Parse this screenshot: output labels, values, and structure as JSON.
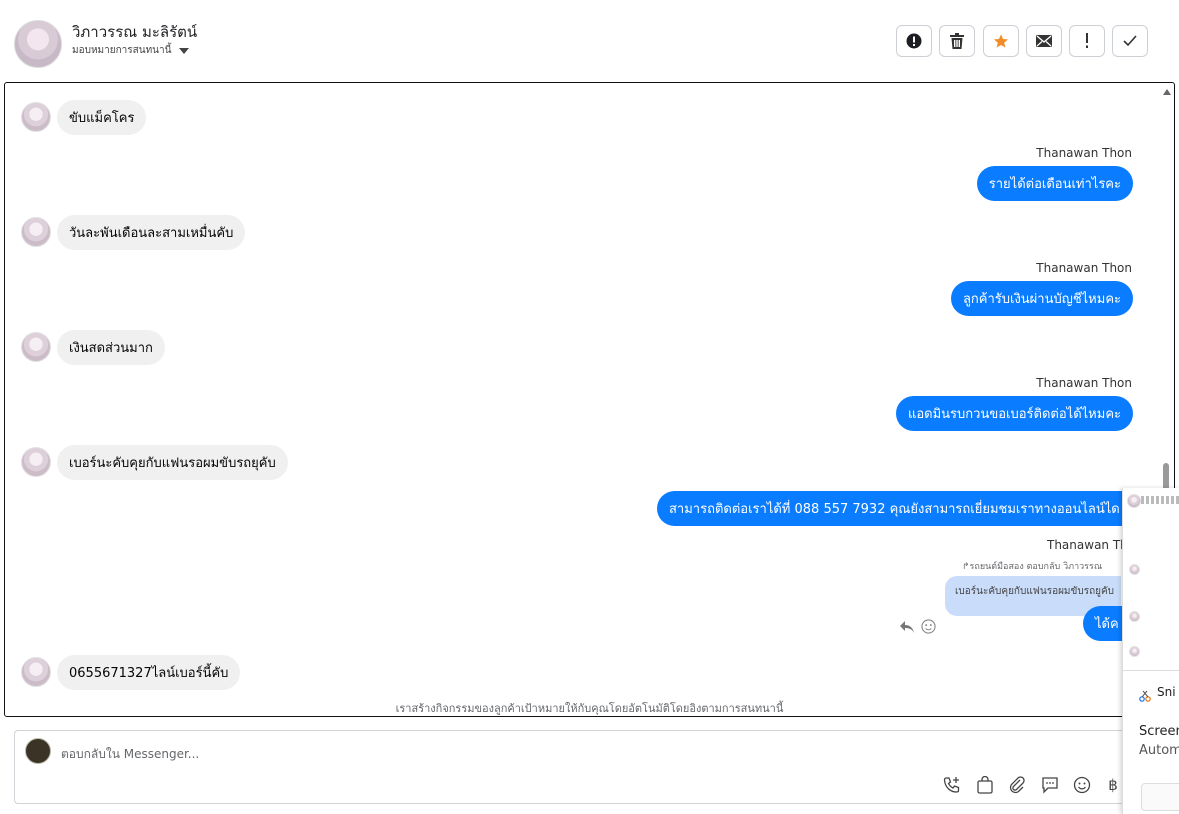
{
  "header": {
    "contact_name": "วิภาวรรณ มะลิรัตน์",
    "assign_label": "มอบหมายการสนทนานี้",
    "toolbar": [
      {
        "name": "spam-button",
        "icon": "alert-circle-icon"
      },
      {
        "name": "delete-button",
        "icon": "trash-icon"
      },
      {
        "name": "star-button",
        "icon": "star-icon",
        "color": "#f28c28"
      },
      {
        "name": "mark-unread-button",
        "icon": "envelope-icon"
      },
      {
        "name": "mark-important-button",
        "icon": "exclamation-icon"
      },
      {
        "name": "done-button",
        "icon": "check-icon"
      }
    ]
  },
  "messages": [
    {
      "dir": "in",
      "text": "ขับแม็คโคร"
    },
    {
      "dir": "out",
      "sender": "Thanawan Thon",
      "text": "รายได้ต่อเดือนเท่าไรคะ"
    },
    {
      "dir": "in",
      "text": "วันละพันเดือนละสามเหมื่นคับ"
    },
    {
      "dir": "out",
      "sender": "Thanawan Thon",
      "text": "ลูกค้ารับเงินผ่านบัญชีไหมคะ"
    },
    {
      "dir": "in",
      "text": "เงินสดส่วนมาก"
    },
    {
      "dir": "out",
      "sender": "Thanawan Thon",
      "text": "แอดมินรบกวนขอเบอร์ติดต่อได้ไหมคะ"
    },
    {
      "dir": "in",
      "text": "เบอร์นะคับคุยกับแฟนรอผมขับรถยุคับ"
    },
    {
      "dir": "out",
      "text": "สามารถติดต่อเราได้ที่ 088 557 7932 คุณยังสามารถเยี่ยมชมเราทางออนไลน์ได"
    },
    {
      "dir": "out",
      "sender": "Thanawan Tho",
      "reply_meta": "รถยนต์มือสอง ตอบกลับ วิภาวรรณ",
      "quoted": "เบอร์นะคับคุยกับแฟนรอผมขับรถยูคับ",
      "text": "ได้ค"
    },
    {
      "dir": "in",
      "text": "0655671327ไลน์เบอร์นี้คับ"
    }
  ],
  "footer_note": "เราสร้างกิจกรรมของลูกค้าเป้าหมายให้กับคุณโดยอัตโนมัติโดยอิงตามการสนทนานี้",
  "composer": {
    "placeholder": "ตอบกลับใน Messenger...",
    "tools": [
      "phone-add-icon",
      "shopping-bag-icon",
      "paperclip-icon",
      "chat-bubble-icon",
      "emoji-icon",
      "baht-icon"
    ]
  },
  "overlay": {
    "app_label": "Sni",
    "line1": "Screen",
    "line2": "Autom"
  },
  "colors": {
    "accent": "#0a7cff",
    "incoming": "#f0f0f0",
    "star": "#f28c28"
  }
}
